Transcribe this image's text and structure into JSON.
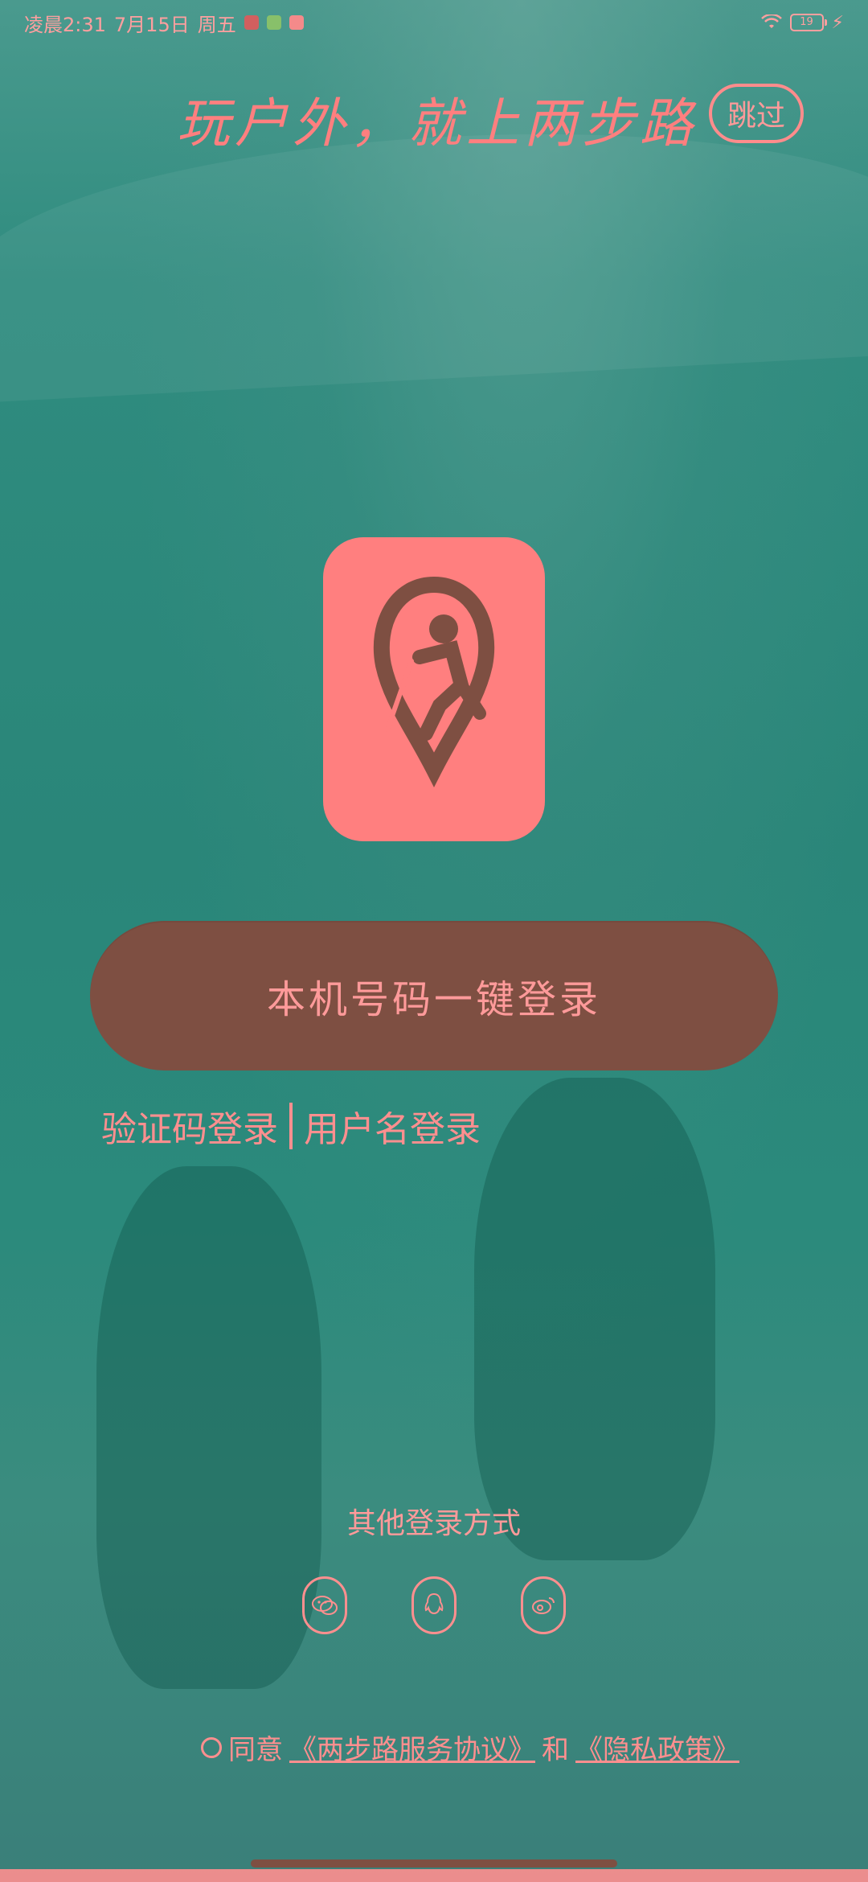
{
  "status_bar": {
    "time_text": "凌晨2:31",
    "date_text": "7月15日",
    "weekday_text": "周五",
    "battery_text": "19"
  },
  "header": {
    "slogan": "玩户外，就上两步路",
    "skip_label": "跳过"
  },
  "login": {
    "primary_button": "本机号码一键登录",
    "verify_code_login": "验证码登录",
    "username_login": "用户名登录"
  },
  "other_methods": {
    "title": "其他登录方式",
    "icons": [
      "wechat-icon",
      "qq-icon",
      "weibo-icon"
    ]
  },
  "agreement": {
    "prefix": "同意",
    "service_agreement": "《两步路服务协议》",
    "connector": "和",
    "privacy_policy": "《隐私政策》"
  }
}
